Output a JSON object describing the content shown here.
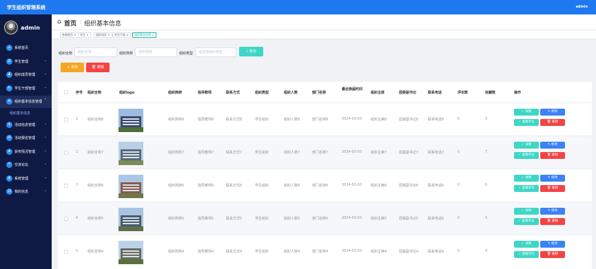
{
  "header": {
    "app_title": "学生组织管理系统",
    "user": "admin"
  },
  "sidebar": {
    "username": "admin",
    "items": [
      {
        "label": "系统首页",
        "expandable": false
      },
      {
        "label": "学生管理",
        "expandable": true
      },
      {
        "label": "组织成员管理",
        "expandable": true
      },
      {
        "label": "学生干部管理",
        "expandable": true
      },
      {
        "label": "组织基本信息管理",
        "expandable": true,
        "expanded": true
      },
      {
        "label": "活动信息管理",
        "expandable": true
      },
      {
        "label": "活动报名管理",
        "expandable": true
      },
      {
        "label": "获奖情况管理",
        "expandable": true
      },
      {
        "label": "交流论坛",
        "expandable": true
      },
      {
        "label": "系统管理",
        "expandable": true
      },
      {
        "label": "我的信息",
        "expandable": true
      }
    ],
    "sub_item": "组织基本信息"
  },
  "breadcrumb": {
    "home": "首页",
    "current": "组织基本信息"
  },
  "tags": [
    "系统首页",
    "学生",
    "组织成员",
    "学生干部",
    "组织基本信息"
  ],
  "search": {
    "name_label": "组织全称",
    "name_placeholder": "组织全称",
    "short_label": "组织简称",
    "short_placeholder": "组织简称",
    "type_label": "组织类型",
    "type_placeholder": "请选择组织类型",
    "search_button": "查询"
  },
  "toolbar": {
    "add_label": "添加",
    "delete_label": "删除"
  },
  "table": {
    "headers": [
      "序号",
      "组织全称",
      "组织logo",
      "组织简称",
      "指导教师",
      "联系方式",
      "组织类型",
      "组织人数",
      "部门名称",
      "最近换届时间",
      "组织主席",
      "团委副书记",
      "联系电话",
      "评论数",
      "收藏数",
      "操作"
    ],
    "rows": [
      {
        "index": "1",
        "name": "组织全称8",
        "short": "组织简称8",
        "teacher": "指导教师8",
        "contact": "联系方式8",
        "type": "学生组织",
        "people": "组织人数8",
        "dept": "部门名称8",
        "date": "2024-03-03",
        "chair": "组织主席8",
        "secretary": "团委副书记8",
        "phone": "联系电话8",
        "comments": "0",
        "favorites": "0"
      },
      {
        "index": "2",
        "name": "组织全称7",
        "short": "组织简称7",
        "teacher": "指导教师7",
        "contact": "联系方式7",
        "type": "学生组织",
        "people": "组织人数7",
        "dept": "部门名称7",
        "date": "2024-03-03",
        "chair": "组织主席7",
        "secretary": "团委副书记7",
        "phone": "联系电话7",
        "comments": "0",
        "favorites": "7"
      },
      {
        "index": "3",
        "name": "组织全称6",
        "short": "组织简称6",
        "teacher": "指导教师6",
        "contact": "联系方式6",
        "type": "学生组织",
        "people": "组织人数6",
        "dept": "部门名称6",
        "date": "2024-03-03",
        "chair": "组织主席6",
        "secretary": "团委副书记6",
        "phone": "联系电话6",
        "comments": "0",
        "favorites": "6"
      },
      {
        "index": "4",
        "name": "组织全称5",
        "short": "组织简称5",
        "teacher": "指导教师5",
        "contact": "联系方式5",
        "type": "学生组织",
        "people": "组织人数5",
        "dept": "部门名称5",
        "date": "2024-03-03",
        "chair": "组织主席5",
        "secretary": "团委副书记5",
        "phone": "联系电话5",
        "comments": "0",
        "favorites": "5"
      },
      {
        "index": "5",
        "name": "组织全称4",
        "short": "组织简称4",
        "teacher": "指导教师4",
        "contact": "联系方式4",
        "type": "学生组织",
        "people": "组织人数4",
        "dept": "部门名称4",
        "date": "2024-03-03",
        "chair": "组织主席4",
        "secretary": "团委副书记4",
        "phone": "联系电话4",
        "comments": "0",
        "favorites": "4"
      }
    ]
  },
  "row_actions": {
    "detail": "详情",
    "edit": "修改",
    "comment": "查看评论",
    "delete": "删除"
  },
  "colors": {
    "topbar": "#1e78f0",
    "sidebar": "#0e1a44",
    "accent": "#3ed6c6",
    "primary": "#3b82f6",
    "danger": "#f44343",
    "warning": "#f5a623"
  }
}
